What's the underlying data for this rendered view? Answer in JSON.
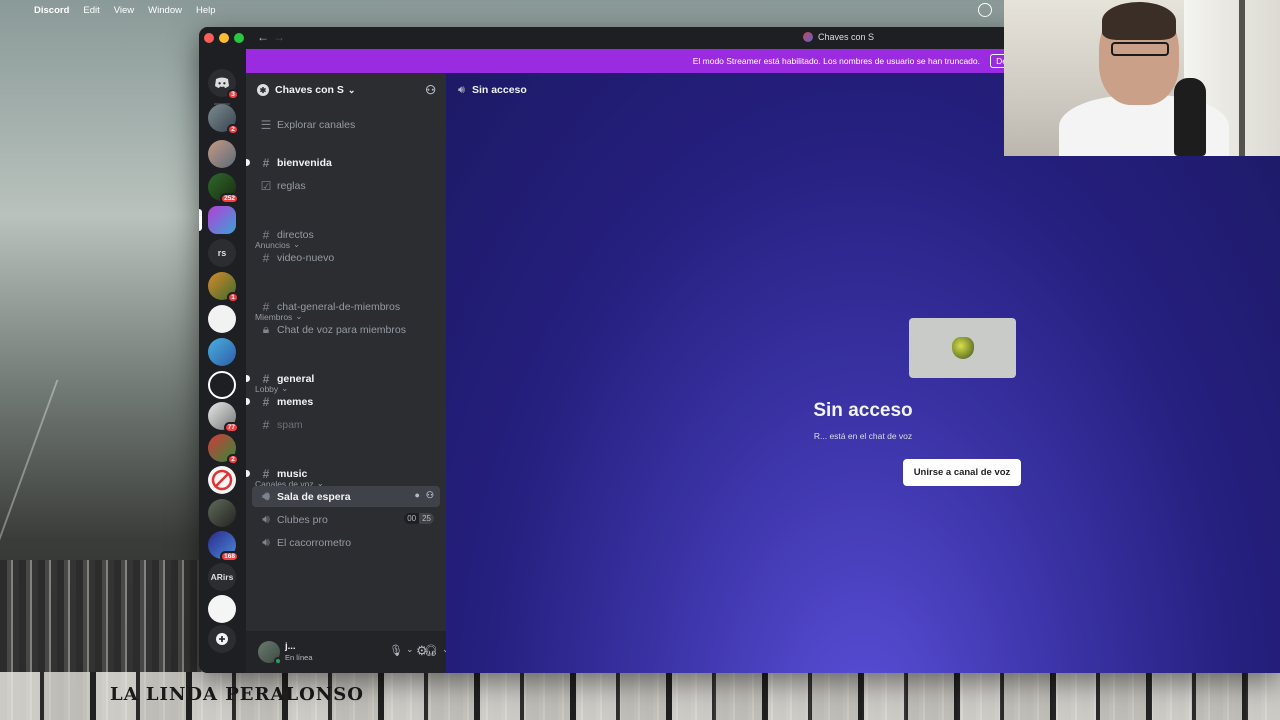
{
  "menubar": {
    "app": "Discord",
    "items": [
      "Edit",
      "View",
      "Window",
      "Help"
    ]
  },
  "window": {
    "title": "Chaves con S"
  },
  "banner": {
    "text": "El modo Streamer está habilitado. Los nombres de usuario se han truncado.",
    "action": "Desh"
  },
  "rail": {
    "badges": {
      "home": "3",
      "s1": "2",
      "s3": "252",
      "s6": "1",
      "s10": "77",
      "s11": "2",
      "s14": "168"
    },
    "text_servers": {
      "rs": "rs",
      "arirs": "ARirs"
    }
  },
  "server": {
    "name": "Chaves con S",
    "explore": "Explorar canales"
  },
  "channels": {
    "bienvenida": "bienvenida",
    "reglas": "reglas",
    "cat_anuncios": "Anuncios",
    "directos": "directos",
    "video_nuevo": "video-nuevo",
    "cat_miembros": "Miembros",
    "chat_general": "chat-general-de-miembros",
    "voz_miembros": "Chat de voz para miembros",
    "cat_lobby": "Lobby",
    "general": "general",
    "memes": "memes",
    "spam": "spam",
    "cat_voz": "Canales de voz",
    "music": "music",
    "sala": "Sala de espera",
    "clubes": "Clubes pro",
    "clubes_count_a": "00",
    "clubes_count_b": "25",
    "cacorrometro": "El cacorrometro"
  },
  "user": {
    "name": "j...",
    "status": "En línea"
  },
  "main": {
    "header": "Sin acceso",
    "title": "Sin acceso",
    "subtitle": "R... está en el chat de voz",
    "join_button": "Unirse a canal de voz"
  },
  "background": {
    "banner_text": "LA LINDA PERALONSO"
  },
  "colors": {
    "streamer_banner": "#9b2be0",
    "sidebar": "#2b2d31",
    "rail": "#1e1f22",
    "main_gradient": "#3b33a6"
  }
}
